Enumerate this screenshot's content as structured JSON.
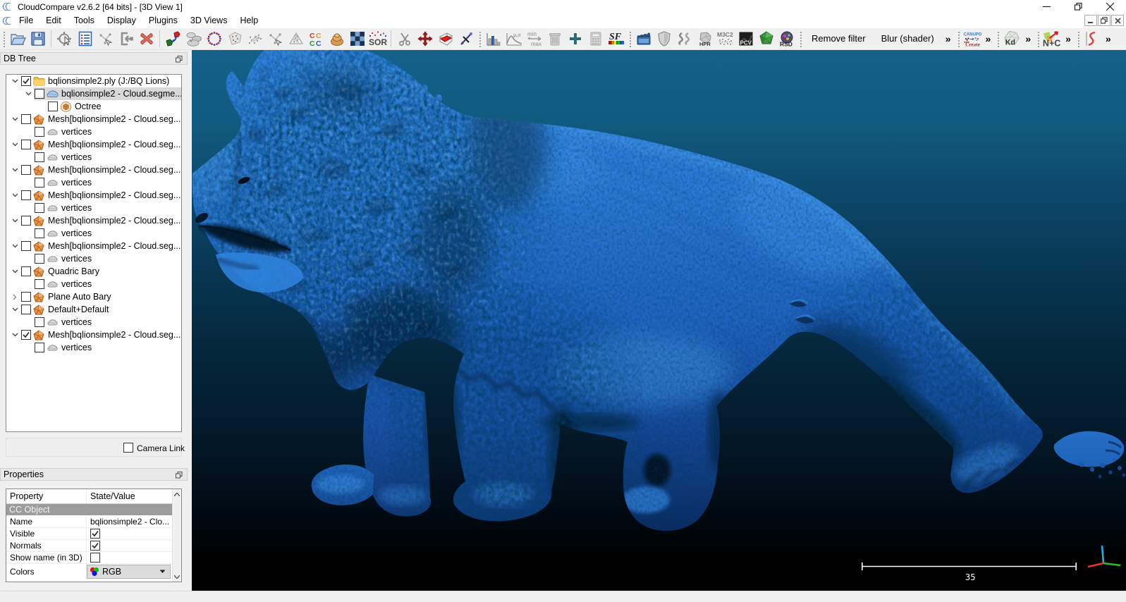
{
  "window": {
    "title": "CloudCompare v2.6.2 [64 bits] - [3D View 1]"
  },
  "menu": {
    "items": [
      "File",
      "Edit",
      "Tools",
      "Display",
      "Plugins",
      "3D Views",
      "Help"
    ]
  },
  "toolbar": {
    "groups": [
      {
        "name": "file",
        "icons": [
          {
            "name": "open-file-icon",
            "type": "open"
          },
          {
            "name": "save-icon",
            "type": "save"
          }
        ]
      },
      {
        "name": "main-tools",
        "icons": [
          {
            "name": "pick-rotation-center-icon",
            "type": "rotcenter"
          },
          {
            "name": "display-options-icon",
            "type": "displist"
          },
          {
            "name": "point-picking-icon",
            "type": "pointpick"
          },
          {
            "name": "apply-transformation-icon",
            "type": "applytrans"
          },
          {
            "name": "delete-icon",
            "type": "delete"
          }
        ]
      },
      {
        "name": "edit-tools",
        "icons": [
          {
            "name": "clone-icon",
            "type": "clone"
          },
          {
            "name": "merge-clouds-icon",
            "type": "merge"
          },
          {
            "name": "subsample-icon",
            "type": "subsample"
          },
          {
            "name": "extract-section-icon",
            "type": "extract"
          },
          {
            "name": "connected-components-icon",
            "type": "connected"
          },
          {
            "name": "resample-icon",
            "type": "pointpick"
          },
          {
            "name": "mesh-sampling-icon",
            "type": "meshsamp"
          },
          {
            "name": "cloud-cloud-distance-icon",
            "type": "ccdist"
          },
          {
            "name": "compute-mesh-icon",
            "type": "clay"
          },
          {
            "name": "noise-filter-icon",
            "type": "noise"
          },
          {
            "name": "sor-filter-icon",
            "type": "sor"
          }
        ]
      },
      {
        "name": "segmentation-tools",
        "icons": [
          {
            "name": "segment-scissors-icon",
            "type": "scissors"
          },
          {
            "name": "translate-rotate-icon",
            "type": "pivot"
          },
          {
            "name": "cross-section-icon",
            "type": "crosssec"
          },
          {
            "name": "point-pair-align-icon",
            "type": "level"
          }
        ]
      },
      {
        "name": "sf-tools",
        "icons": [
          {
            "name": "histogram-icon",
            "type": "histogram"
          },
          {
            "name": "fit-distribution-icon",
            "type": "fitdist"
          },
          {
            "name": "min-max-icon",
            "type": "minmax"
          },
          {
            "name": "delete-sf-icon",
            "type": "trash"
          },
          {
            "name": "add-sf-icon",
            "type": "plus"
          },
          {
            "name": "sf-arithmetic-icon",
            "type": "calc"
          },
          {
            "name": "sf-color-scale-icon",
            "type": "sfrainbow"
          }
        ]
      },
      {
        "name": "plugins",
        "icons": [
          {
            "name": "animation-plugin-icon",
            "type": "film"
          },
          {
            "name": "shade-plugin-icon",
            "type": "shield"
          },
          {
            "name": "ssao-plugin-icon",
            "type": "ss"
          },
          {
            "name": "hpr-plugin-icon",
            "type": "hpr"
          },
          {
            "name": "m3c2-plugin-icon",
            "type": "m3c2"
          },
          {
            "name": "pcv-plugin-icon",
            "type": "pcv"
          },
          {
            "name": "facets-plugin-icon",
            "type": "facets"
          },
          {
            "name": "rsd-plugin-icon",
            "type": "rsd"
          }
        ]
      }
    ],
    "shader_buttons": {
      "remove_filter_label": "Remove filter",
      "blur_shader_label": "Blur (shader)"
    },
    "overflow_glyph": "»",
    "plugin_buttons": [
      {
        "name": "canupo-plugin-icon",
        "type": "canupo"
      },
      {
        "name": "kd-tree-plugin-icon",
        "type": "kd"
      },
      {
        "name": "normals-plugin-icon",
        "type": "nc"
      },
      {
        "name": "spline-plugin-icon",
        "type": "scurve"
      }
    ]
  },
  "db_tree": {
    "title": "DB Tree",
    "camera_link_label": "Camera Link",
    "items": [
      {
        "depth": 0,
        "expander": "down",
        "checked": true,
        "icon": "folder",
        "label": "bqlionsimple2.ply (J:/BQ Lions)",
        "selected": false
      },
      {
        "depth": 1,
        "expander": "down",
        "checked": false,
        "icon": "cloud",
        "label": "bqlionsimple2 - Cloud.segme...",
        "selected": true
      },
      {
        "depth": 2,
        "expander": "none",
        "checked": false,
        "icon": "octree",
        "label": "Octree",
        "selected": false
      },
      {
        "depth": 0,
        "expander": "down",
        "checked": false,
        "icon": "mesh",
        "label": "Mesh[bqlionsimple2 - Cloud.seg...",
        "selected": false
      },
      {
        "depth": 1,
        "expander": "none",
        "checked": false,
        "icon": "vertices",
        "label": "vertices",
        "selected": false
      },
      {
        "depth": 0,
        "expander": "down",
        "checked": false,
        "icon": "mesh",
        "label": "Mesh[bqlionsimple2 - Cloud.seg...",
        "selected": false
      },
      {
        "depth": 1,
        "expander": "none",
        "checked": false,
        "icon": "vertices",
        "label": "vertices",
        "selected": false
      },
      {
        "depth": 0,
        "expander": "down",
        "checked": false,
        "icon": "mesh",
        "label": "Mesh[bqlionsimple2 - Cloud.seg...",
        "selected": false
      },
      {
        "depth": 1,
        "expander": "none",
        "checked": false,
        "icon": "vertices",
        "label": "vertices",
        "selected": false
      },
      {
        "depth": 0,
        "expander": "down",
        "checked": false,
        "icon": "mesh",
        "label": "Mesh[bqlionsimple2 - Cloud.seg...",
        "selected": false
      },
      {
        "depth": 1,
        "expander": "none",
        "checked": false,
        "icon": "vertices",
        "label": "vertices",
        "selected": false
      },
      {
        "depth": 0,
        "expander": "down",
        "checked": false,
        "icon": "mesh",
        "label": "Mesh[bqlionsimple2 - Cloud.seg...",
        "selected": false
      },
      {
        "depth": 1,
        "expander": "none",
        "checked": false,
        "icon": "vertices",
        "label": "vertices",
        "selected": false
      },
      {
        "depth": 0,
        "expander": "down",
        "checked": false,
        "icon": "mesh",
        "label": "Mesh[bqlionsimple2 - Cloud.seg...",
        "selected": false
      },
      {
        "depth": 1,
        "expander": "none",
        "checked": false,
        "icon": "vertices",
        "label": "vertices",
        "selected": false
      },
      {
        "depth": 0,
        "expander": "down",
        "checked": false,
        "icon": "mesh",
        "label": "Quadric Bary",
        "selected": false
      },
      {
        "depth": 1,
        "expander": "none",
        "checked": false,
        "icon": "vertices",
        "label": "vertices",
        "selected": false
      },
      {
        "depth": 0,
        "expander": "right",
        "checked": false,
        "icon": "mesh",
        "label": "Plane Auto Bary",
        "selected": false
      },
      {
        "depth": 0,
        "expander": "down",
        "checked": false,
        "icon": "mesh",
        "label": "Default+Default",
        "selected": false
      },
      {
        "depth": 1,
        "expander": "none",
        "checked": false,
        "icon": "vertices",
        "label": "vertices",
        "selected": false
      },
      {
        "depth": 0,
        "expander": "down",
        "checked": true,
        "icon": "mesh",
        "label": "Mesh[bqlionsimple2 - Cloud.seg...",
        "selected": false
      },
      {
        "depth": 1,
        "expander": "none",
        "checked": false,
        "icon": "vertices",
        "label": "vertices",
        "selected": false
      }
    ]
  },
  "properties": {
    "title": "Properties",
    "columns": [
      "Property",
      "State/Value"
    ],
    "rows": [
      {
        "kind": "section",
        "label": "CC Object"
      },
      {
        "kind": "text",
        "label": "Name",
        "value": "bqlionsimple2 - Clo..."
      },
      {
        "kind": "checkbox",
        "label": "Visible",
        "checked": true
      },
      {
        "kind": "checkbox",
        "label": "Normals",
        "checked": true
      },
      {
        "kind": "checkbox",
        "label": "Show name (in 3D)",
        "checked": false
      },
      {
        "kind": "combo",
        "label": "Colors",
        "value": "RGB"
      }
    ]
  },
  "viewport": {
    "scale_bar_label": "35",
    "background_top": "#15618a",
    "background_bottom": "#000000",
    "mesh_color": "#2374d2",
    "axis_colors": {
      "x": "#e8352c",
      "y": "#27c227",
      "z": "#2fa7e8"
    }
  }
}
